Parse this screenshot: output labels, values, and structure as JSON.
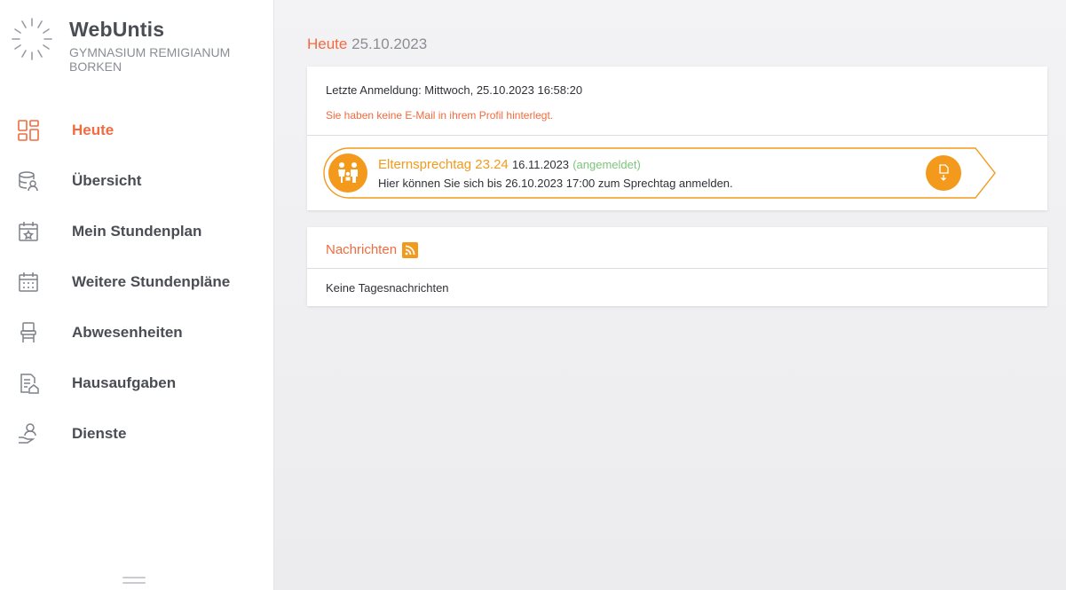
{
  "brand": {
    "title": "WebUntis",
    "school_line1": "GYMNASIUM REMIGIANUM",
    "school_line2": "BORKEN"
  },
  "nav": {
    "items": [
      {
        "label": "Heute",
        "icon": "dashboard-icon",
        "active": true
      },
      {
        "label": "Übersicht",
        "icon": "overview-icon",
        "active": false
      },
      {
        "label": "Mein Stundenplan",
        "icon": "calendar-star-icon",
        "active": false
      },
      {
        "label": "Weitere Stundenpläne",
        "icon": "calendar-grid-icon",
        "active": false
      },
      {
        "label": "Abwesenheiten",
        "icon": "chair-icon",
        "active": false
      },
      {
        "label": "Hausaufgaben",
        "icon": "homework-icon",
        "active": false
      },
      {
        "label": "Dienste",
        "icon": "service-hand-icon",
        "active": false
      }
    ]
  },
  "page": {
    "title": "Heute",
    "date": "25.10.2023"
  },
  "info": {
    "last_login": "Letzte Anmeldung: Mittwoch, 25.10.2023 16:58:20",
    "email_warning": "Sie haben keine E-Mail in ihrem Profil hinterlegt."
  },
  "event": {
    "name": "Elternsprechtag 23.24",
    "date": "16.11.2023",
    "status": "(angemeldet)",
    "description": "Hier können Sie sich bis 26.10.2023 17:00 zum Sprechtag anmelden."
  },
  "news": {
    "title": "Nachrichten",
    "empty": "Keine Tagesnachrichten"
  },
  "colors": {
    "accent": "#f16b3f",
    "event": "#f39a1c",
    "status_ok": "#7cc47c"
  }
}
